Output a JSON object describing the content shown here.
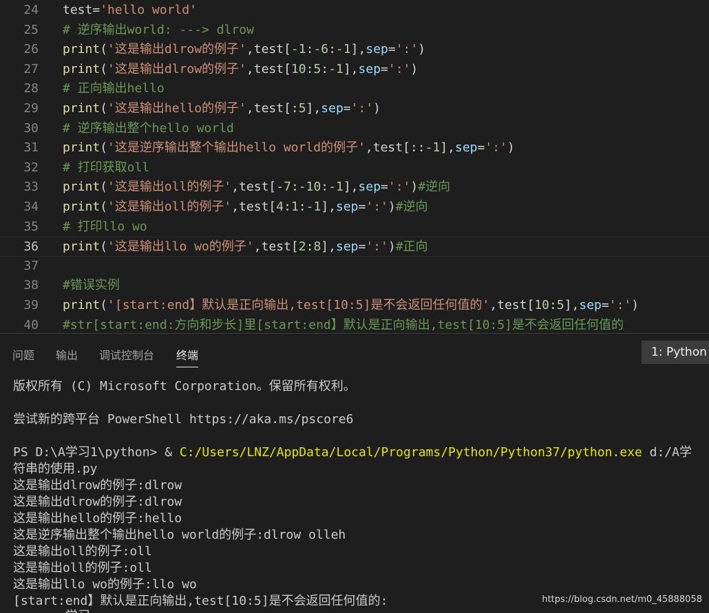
{
  "editor": {
    "lines": [
      {
        "no": "24",
        "tokens": [
          {
            "t": "test=",
            "c": "plain"
          },
          {
            "t": "'hello world'",
            "c": "str"
          }
        ]
      },
      {
        "no": "25",
        "tokens": [
          {
            "t": "# 逆序输出world: ---> dlrow",
            "c": "cmt"
          }
        ]
      },
      {
        "no": "26",
        "tokens": [
          {
            "t": "print",
            "c": "fn"
          },
          {
            "t": "(",
            "c": "plain"
          },
          {
            "t": "'这是输出dlrow的例子'",
            "c": "str"
          },
          {
            "t": ",test[",
            "c": "plain"
          },
          {
            "t": "-1",
            "c": "num"
          },
          {
            "t": ":",
            "c": "plain"
          },
          {
            "t": "-6",
            "c": "num"
          },
          {
            "t": ":",
            "c": "plain"
          },
          {
            "t": "-1",
            "c": "num"
          },
          {
            "t": "],",
            "c": "plain"
          },
          {
            "t": "sep",
            "c": "param"
          },
          {
            "t": "=",
            "c": "plain"
          },
          {
            "t": "':'",
            "c": "str"
          },
          {
            "t": ")",
            "c": "plain"
          }
        ]
      },
      {
        "no": "27",
        "tokens": [
          {
            "t": "print",
            "c": "fn"
          },
          {
            "t": "(",
            "c": "plain"
          },
          {
            "t": "'这是输出dlrow的例子'",
            "c": "str"
          },
          {
            "t": ",test[",
            "c": "plain"
          },
          {
            "t": "10",
            "c": "num"
          },
          {
            "t": ":",
            "c": "plain"
          },
          {
            "t": "5",
            "c": "num"
          },
          {
            "t": ":",
            "c": "plain"
          },
          {
            "t": "-1",
            "c": "num"
          },
          {
            "t": "],",
            "c": "plain"
          },
          {
            "t": "sep",
            "c": "param"
          },
          {
            "t": "=",
            "c": "plain"
          },
          {
            "t": "':'",
            "c": "str"
          },
          {
            "t": ")",
            "c": "plain"
          }
        ]
      },
      {
        "no": "28",
        "tokens": [
          {
            "t": "# 正向输出hello",
            "c": "cmt"
          }
        ]
      },
      {
        "no": "29",
        "tokens": [
          {
            "t": "print",
            "c": "fn"
          },
          {
            "t": "(",
            "c": "plain"
          },
          {
            "t": "'这是输出hello的例子'",
            "c": "str"
          },
          {
            "t": ",test[:",
            "c": "plain"
          },
          {
            "t": "5",
            "c": "num"
          },
          {
            "t": "],",
            "c": "plain"
          },
          {
            "t": "sep",
            "c": "param"
          },
          {
            "t": "=",
            "c": "plain"
          },
          {
            "t": "':'",
            "c": "str"
          },
          {
            "t": ")",
            "c": "plain"
          }
        ]
      },
      {
        "no": "30",
        "tokens": [
          {
            "t": "# 逆序输出整个hello world",
            "c": "cmt"
          }
        ]
      },
      {
        "no": "31",
        "tokens": [
          {
            "t": "print",
            "c": "fn"
          },
          {
            "t": "(",
            "c": "plain"
          },
          {
            "t": "'这是逆序输出整个输出hello world的例子'",
            "c": "str"
          },
          {
            "t": ",test[::",
            "c": "plain"
          },
          {
            "t": "-1",
            "c": "num"
          },
          {
            "t": "],",
            "c": "plain"
          },
          {
            "t": "sep",
            "c": "param"
          },
          {
            "t": "=",
            "c": "plain"
          },
          {
            "t": "':'",
            "c": "str"
          },
          {
            "t": ")",
            "c": "plain"
          }
        ]
      },
      {
        "no": "32",
        "tokens": [
          {
            "t": "# 打印获取oll",
            "c": "cmt"
          }
        ]
      },
      {
        "no": "33",
        "tokens": [
          {
            "t": "print",
            "c": "fn"
          },
          {
            "t": "(",
            "c": "plain"
          },
          {
            "t": "'这是输出oll的例子'",
            "c": "str"
          },
          {
            "t": ",test[",
            "c": "plain"
          },
          {
            "t": "-7",
            "c": "num"
          },
          {
            "t": ":",
            "c": "plain"
          },
          {
            "t": "-10",
            "c": "num"
          },
          {
            "t": ":",
            "c": "plain"
          },
          {
            "t": "-1",
            "c": "num"
          },
          {
            "t": "],",
            "c": "plain"
          },
          {
            "t": "sep",
            "c": "param"
          },
          {
            "t": "=",
            "c": "plain"
          },
          {
            "t": "':'",
            "c": "str"
          },
          {
            "t": ")",
            "c": "plain"
          },
          {
            "t": "#逆向",
            "c": "cmt"
          }
        ]
      },
      {
        "no": "34",
        "tokens": [
          {
            "t": "print",
            "c": "fn"
          },
          {
            "t": "(",
            "c": "plain"
          },
          {
            "t": "'这是输出oll的例子'",
            "c": "str"
          },
          {
            "t": ",test[",
            "c": "plain"
          },
          {
            "t": "4",
            "c": "num"
          },
          {
            "t": ":",
            "c": "plain"
          },
          {
            "t": "1",
            "c": "num"
          },
          {
            "t": ":",
            "c": "plain"
          },
          {
            "t": "-1",
            "c": "num"
          },
          {
            "t": "],",
            "c": "plain"
          },
          {
            "t": "sep",
            "c": "param"
          },
          {
            "t": "=",
            "c": "plain"
          },
          {
            "t": "':'",
            "c": "str"
          },
          {
            "t": ")",
            "c": "plain"
          },
          {
            "t": "#逆向",
            "c": "cmt"
          }
        ]
      },
      {
        "no": "35",
        "tokens": [
          {
            "t": "# 打印llo wo",
            "c": "cmt"
          }
        ]
      },
      {
        "no": "36",
        "current": true,
        "tokens": [
          {
            "t": "print",
            "c": "fn"
          },
          {
            "t": "(",
            "c": "plain"
          },
          {
            "t": "'这是输出llo wo的例子'",
            "c": "str"
          },
          {
            "t": ",test[",
            "c": "plain"
          },
          {
            "t": "2",
            "c": "num"
          },
          {
            "t": ":",
            "c": "plain"
          },
          {
            "t": "8",
            "c": "num"
          },
          {
            "t": "],",
            "c": "plain"
          },
          {
            "t": "sep",
            "c": "param"
          },
          {
            "t": "=",
            "c": "plain"
          },
          {
            "t": "':'",
            "c": "str"
          },
          {
            "t": ")",
            "c": "plain"
          },
          {
            "t": "#正向",
            "c": "cmt"
          }
        ]
      },
      {
        "no": "37",
        "tokens": []
      },
      {
        "no": "38",
        "tokens": [
          {
            "t": "#错误实例",
            "c": "cmt"
          }
        ]
      },
      {
        "no": "39",
        "tokens": [
          {
            "t": "print",
            "c": "fn"
          },
          {
            "t": "(",
            "c": "plain"
          },
          {
            "t": "'[start:end】默认是正向输出,test[10:5]是不会返回任何值的'",
            "c": "str"
          },
          {
            "t": ",test[",
            "c": "plain"
          },
          {
            "t": "10",
            "c": "num"
          },
          {
            "t": ":",
            "c": "plain"
          },
          {
            "t": "5",
            "c": "num"
          },
          {
            "t": "],",
            "c": "plain"
          },
          {
            "t": "sep",
            "c": "param"
          },
          {
            "t": "=",
            "c": "plain"
          },
          {
            "t": "':'",
            "c": "str"
          },
          {
            "t": ")",
            "c": "plain"
          }
        ]
      },
      {
        "no": "40",
        "tokens": [
          {
            "t": "#str[start:end:方向和步长]里[start:end】默认是正向输出,test[10:5]是不会返回任何值的",
            "c": "cmt"
          }
        ]
      }
    ]
  },
  "panel": {
    "tabs": [
      {
        "label": "问题",
        "active": false
      },
      {
        "label": "输出",
        "active": false
      },
      {
        "label": "调试控制台",
        "active": false
      },
      {
        "label": "终端",
        "active": true
      }
    ],
    "terminal_select": "1: Python"
  },
  "terminal": {
    "copyright": "版权所有 (C) Microsoft Corporation。保留所有权利。",
    "pwsh_hint": "尝试新的跨平台 PowerShell https://aka.ms/pscore6",
    "prompt": "PS D:\\A学习1\\python> & ",
    "exe_path": "C:/Users/LNZ/AppData/Local/Programs/Python/Python37/python.exe",
    "script_arg": " d:/A学",
    "script_arg_cont": "符串的使用.py",
    "outputs": [
      "这是输出dlrow的例子:dlrow",
      "这是输出dlrow的例子:dlrow",
      "这是输出hello的例子:hello",
      "这是逆序输出整个输出hello world的例子:dlrow olleh",
      "这是输出oll的例子:oll",
      "这是输出oll的例子:oll",
      "这是输出llo wo的例子:llo wo",
      "[start:end】默认是正向输出,test[10:5]是不会返回任何值的:"
    ],
    "cut_line": "       学习"
  },
  "watermark": "https://blog.csdn.net/m0_45888058",
  "colors": {
    "background": "#1e1e1e",
    "function": "#dcdcaa",
    "string": "#ce9178",
    "comment": "#6a9955",
    "parameter": "#9cdcfe",
    "number": "#b5cea8",
    "path": "#e5e510"
  }
}
